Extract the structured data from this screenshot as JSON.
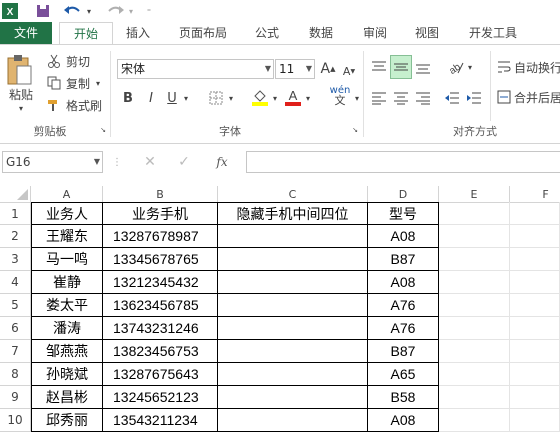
{
  "qat": {
    "excel_icon": "excel-logo-icon",
    "save_icon": "save-icon",
    "undo_icon": "undo-icon",
    "redo_icon": "redo-icon"
  },
  "tabs": [
    {
      "label": "文件"
    },
    {
      "label": "开始"
    },
    {
      "label": "插入"
    },
    {
      "label": "页面布局"
    },
    {
      "label": "公式"
    },
    {
      "label": "数据"
    },
    {
      "label": "审阅"
    },
    {
      "label": "视图"
    },
    {
      "label": "开发工具"
    }
  ],
  "ribbon": {
    "clipboard": {
      "paste": "粘贴",
      "cut": "剪切",
      "copy": "复制",
      "format_painter": "格式刷",
      "group": "剪贴板"
    },
    "font": {
      "name": "宋体",
      "size": "11",
      "bold": "B",
      "italic": "I",
      "underline": "U",
      "wen": "wén",
      "group": "字体",
      "grow": "A",
      "shrink": "A"
    },
    "alignment": {
      "wrap": "自动换行",
      "merge": "合并后居",
      "group": "对齐方式"
    }
  },
  "formula_bar": {
    "name_box": "G16",
    "fx": "fx",
    "formula": ""
  },
  "columns": [
    "A",
    "B",
    "C",
    "D",
    "E",
    "F"
  ],
  "rows": [
    "1",
    "2",
    "3",
    "4",
    "5",
    "6",
    "7",
    "8",
    "9",
    "10"
  ],
  "table": {
    "headers": [
      "业务人",
      "业务手机",
      "隐藏手机中间四位",
      "型号"
    ],
    "data": [
      [
        "王耀东",
        "13287678987",
        "",
        "A08"
      ],
      [
        "马一鸣",
        "13345678765",
        "",
        "B87"
      ],
      [
        "崔静",
        "13212345432",
        "",
        "A08"
      ],
      [
        "娄太平",
        "13623456785",
        "",
        "A76"
      ],
      [
        "潘涛",
        "13743231246",
        "",
        "A76"
      ],
      [
        "邹燕燕",
        "13823456753",
        "",
        "B87"
      ],
      [
        "孙晓斌",
        "13287675643",
        "",
        "A65"
      ],
      [
        "赵昌彬",
        "13245652123",
        "",
        "B58"
      ],
      [
        "邱秀丽",
        "13543211234",
        "",
        "A08"
      ]
    ]
  },
  "colors": {
    "brand": "#217346",
    "accent_fill": "#c6efce"
  }
}
